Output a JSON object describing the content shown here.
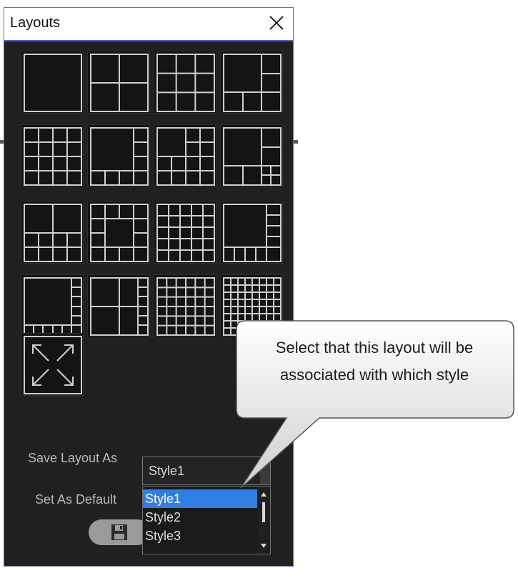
{
  "window": {
    "title": "Layouts",
    "close_icon": "close-icon",
    "border_color": "#5f6fb8"
  },
  "layout_grid": {
    "tiles": [
      "single-view-icon",
      "quad-view-icon",
      "grid-3x3-icon",
      "main-plus-5-icon",
      "grid-4x4-icon",
      "main-plus-7-icon",
      "main-plus-9-icon",
      "main-plus-6-icon",
      "quad-plus-8-icon",
      "center-plus-12-icon",
      "grid-5x5-icon",
      "main-plus-13-icon",
      "main-plus-side-icon",
      "quad-plus-side-icon",
      "grid-6x6-icon",
      "grid-8x8-icon"
    ],
    "fullscreen_icon": "fullscreen-expand-icon",
    "line_color": "#cfcfcf"
  },
  "form": {
    "save_layout_label": "Save Layout As",
    "set_default_label": "Set As Default",
    "selected_style": "Style1",
    "options": [
      "Style1",
      "Style2",
      "Style3"
    ],
    "highlight_color": "#2f7ee3"
  },
  "buttons": {
    "save_icon": "floppy-disk-icon",
    "collapse_icon": "chevron-up-icon"
  },
  "callout": {
    "line1": "Select that this layout will be",
    "line2": "associated with which style"
  }
}
